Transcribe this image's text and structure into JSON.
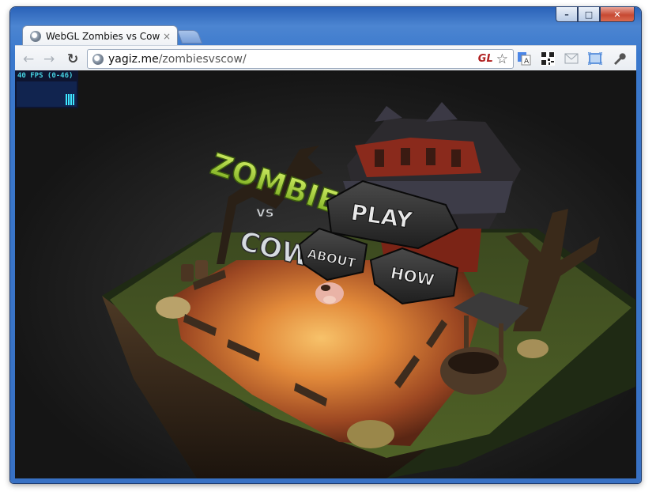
{
  "browser": {
    "tab_title": "WebGL Zombies vs Cow",
    "tab_close": "×",
    "url_host": "yagiz.me",
    "url_path": "/zombiesvscow/",
    "gl_badge": "GL"
  },
  "window_controls": {
    "minimize": "–",
    "maximize": "□",
    "close": "✕"
  },
  "fps_meter": {
    "label": "40 FPS (0-46)"
  },
  "game": {
    "logo_top": "ZOMBIES",
    "logo_vs": "vs",
    "logo_bottom": "COW",
    "menu": {
      "play": "PLAY",
      "about": "ABOUT",
      "how": "HOW"
    }
  },
  "colors": {
    "accent": "#3871c4",
    "title_bar": "#4c85d1",
    "fps_text": "#46d1e0",
    "zombies_green": "#9ccf2a"
  }
}
